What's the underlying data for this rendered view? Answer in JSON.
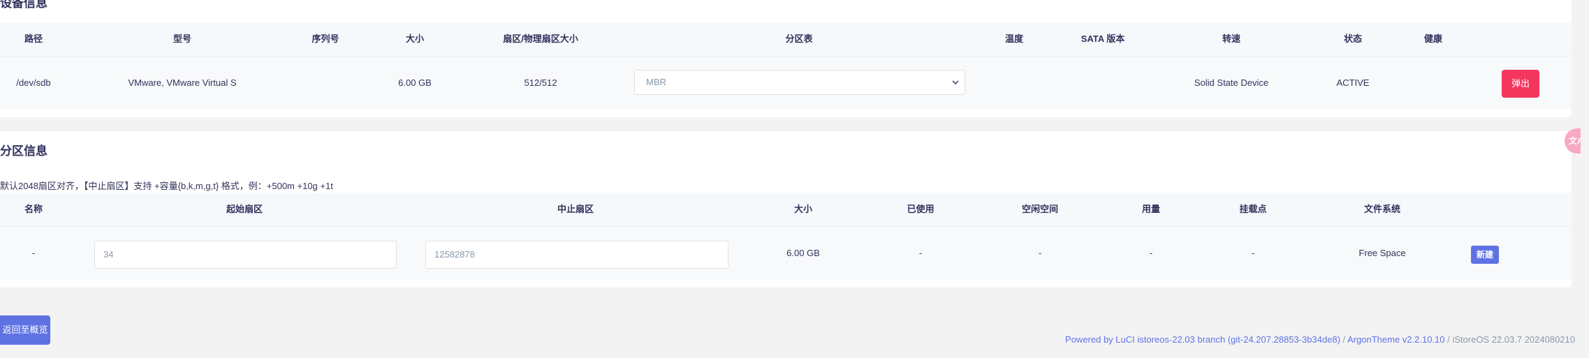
{
  "device": {
    "title": "设备信息",
    "headers": {
      "path": "路径",
      "model": "型号",
      "serial": "序列号",
      "size": "大小",
      "sector": "扇区/物理扇区大小",
      "partition_table": "分区表",
      "temperature": "温度",
      "sata": "SATA 版本",
      "rpm": "转速",
      "status": "状态",
      "health": "健康"
    },
    "row": {
      "path": "/dev/sdb",
      "model": "VMware, VMware Virtual S",
      "size": "6.00 GB",
      "sector": "512/512",
      "partition_table": "MBR",
      "rpm": "Solid State Device",
      "status": "ACTIVE",
      "eject_label": "弹出"
    }
  },
  "partition": {
    "title": "分区信息",
    "hint": "默认2048扇区对齐，【中止扇区】支持 +容量{b,k,m,g,t} 格式，例：+500m +10g +1t",
    "headers": {
      "name": "名称",
      "start": "起始扇区",
      "end": "中止扇区",
      "size": "大小",
      "used": "已使用",
      "free": "空闲空间",
      "usage": "用量",
      "mount": "挂载点",
      "fs": "文件系统"
    },
    "row": {
      "name": "-",
      "start_placeholder": "34",
      "end_placeholder": "12582878",
      "size": "6.00 GB",
      "used": "-",
      "free": "-",
      "usage": "-",
      "mount": "-",
      "fs": "Free Space",
      "new_label": "新建"
    }
  },
  "back_label": "返回至概览",
  "footer": {
    "powered": "Powered by LuCI istoreos-22.03 branch (git-24.207.28853-3b34de8)",
    "sep1": " / ",
    "theme": "ArgonTheme v2.2.10.10",
    "sep2": " / ",
    "os": "iStoreOS 22.03.7 2024080210"
  },
  "translate_icon": "translate-icon",
  "colors": {
    "primary": "#5e72e4",
    "danger": "#f5365c",
    "text": "#32325d",
    "muted": "#8898aa",
    "background": "#f3f3f4"
  }
}
